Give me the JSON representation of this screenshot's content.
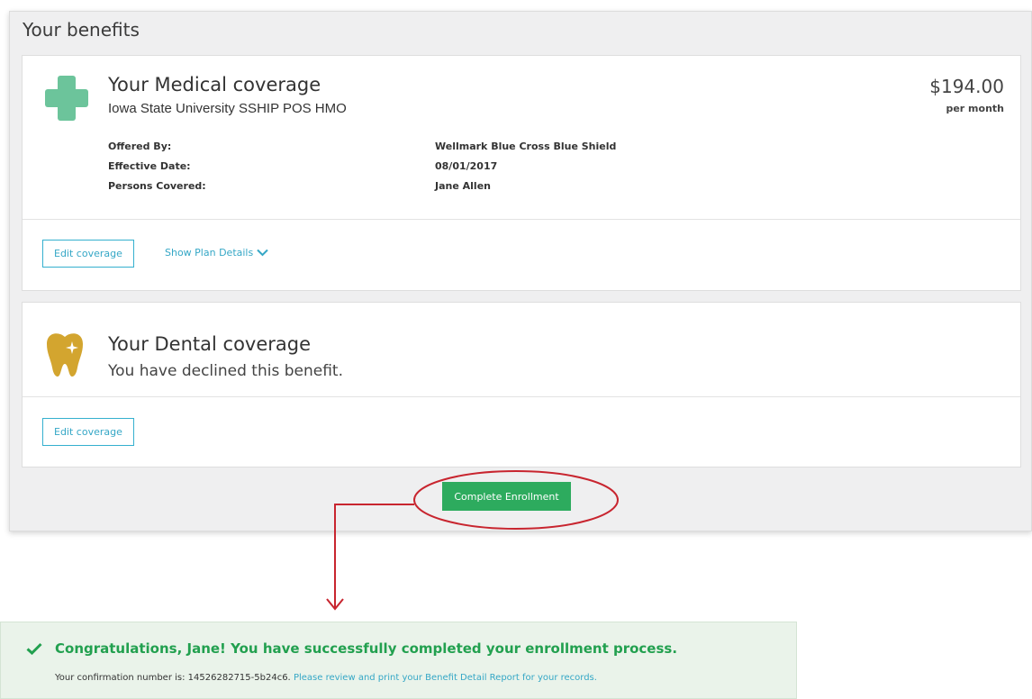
{
  "panel": {
    "title": "Your benefits"
  },
  "medical": {
    "icon": "medical-cross-icon",
    "heading": "Your Medical coverage",
    "plan_name": "Iowa State University SSHIP POS HMO",
    "price": "$194.00",
    "price_period": "per month",
    "details": [
      {
        "label": "Offered By:",
        "value": "Wellmark Blue Cross Blue Shield"
      },
      {
        "label": "Effective Date:",
        "value": "08/01/2017"
      },
      {
        "label": "Persons Covered:",
        "value": "Jane Allen"
      }
    ],
    "edit_label": "Edit coverage",
    "plan_details_label": "Show Plan Details"
  },
  "dental": {
    "icon": "tooth-icon",
    "heading": "Your Dental coverage",
    "status": "You have declined this benefit.",
    "edit_label": "Edit coverage"
  },
  "complete_label": "Complete Enrollment",
  "success": {
    "icon": "checkmark-icon",
    "title": "Congratulations, Jane! You have successfully completed your enrollment process.",
    "confirmation_prefix": "Your confirmation number is: ",
    "confirmation_number": "14526282715-5b24c6.",
    "review_link": "Please review and print your Benefit Detail Report for your records."
  },
  "colors": {
    "accent_green": "#2dab5e",
    "link_blue": "#35a7c6",
    "medical_icon": "#6cc49b",
    "dental_icon": "#d3a52f",
    "annotation_red": "#c8252f"
  }
}
